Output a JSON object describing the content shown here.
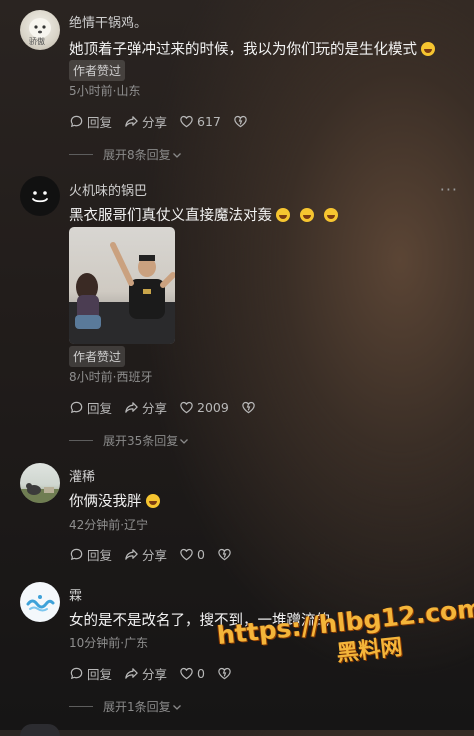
{
  "comments": [
    {
      "name": "绝情干锅鸡。",
      "avatar_text": "骄傲",
      "text": "她顶着子弹冲过来的时候，我以为你们玩的是生化模式",
      "badge": "作者赞过",
      "meta": "5小时前·山东",
      "reply": "回复",
      "share": "分享",
      "likes": "617",
      "expand": "展开8条回复"
    },
    {
      "name": "火机味的锅巴",
      "text": "黑衣服哥们真仗义直接魔法对轰",
      "badge": "作者赞过",
      "meta": "8小时前·西班牙",
      "reply": "回复",
      "share": "分享",
      "likes": "2009",
      "expand": "展开35条回复",
      "more": "···"
    },
    {
      "name": "灌稀",
      "text": "你俩没我胖",
      "meta": "42分钟前·辽宁",
      "reply": "回复",
      "share": "分享",
      "likes": "0"
    },
    {
      "name": "霖",
      "text": "女的是不是改名了，搜不到，一堆蹭流的",
      "meta": "10分钟前·广东",
      "reply": "回复",
      "share": "分享",
      "likes": "0",
      "expand": "展开1条回复"
    }
  ],
  "watermark": {
    "line1": "https://hlbg12.com",
    "line2": "黑料网"
  },
  "icons": [
    "reply-icon",
    "share-icon",
    "heart-icon",
    "dislike-icon",
    "chevron-down-icon"
  ],
  "colors": {
    "background": "#221d1b",
    "watermark": "#f4b53a",
    "emoji": "#f6c530"
  }
}
